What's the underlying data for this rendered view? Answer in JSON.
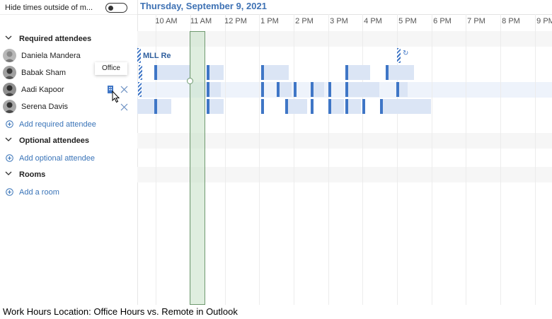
{
  "left_panel": {
    "hide_times_label": "Hide times outside of m...",
    "hide_times_enabled": false,
    "required_header": "Required attendees",
    "attendees": [
      {
        "name": "Daniela Mandera"
      },
      {
        "name": "Babak Sham"
      },
      {
        "name": "Aadi Kapoor"
      },
      {
        "name": "Serena Davis"
      }
    ],
    "add_required": "Add required attendee",
    "optional_header": "Optional attendees",
    "add_optional": "Add optional attendee",
    "rooms_header": "Rooms",
    "add_room": "Add a room"
  },
  "tooltip": "Office",
  "timeline": {
    "date": "Thursday, September 9, 2021",
    "hours": [
      "10 AM",
      "11 AM",
      "12 PM",
      "1 PM",
      "2 PM",
      "3 PM",
      "4 PM",
      "5 PM",
      "6 PM",
      "7 PM",
      "8 PM",
      "9 PM"
    ],
    "event_title": "MLL Re"
  },
  "colors": {
    "accent": "#3f72b4",
    "busy_mark": "#3f76c6",
    "busy_fill": "#dbe5f5",
    "selection": "#d4e6d4"
  },
  "caption": "Work Hours Location: Office Hours vs. Remote in Outlook"
}
